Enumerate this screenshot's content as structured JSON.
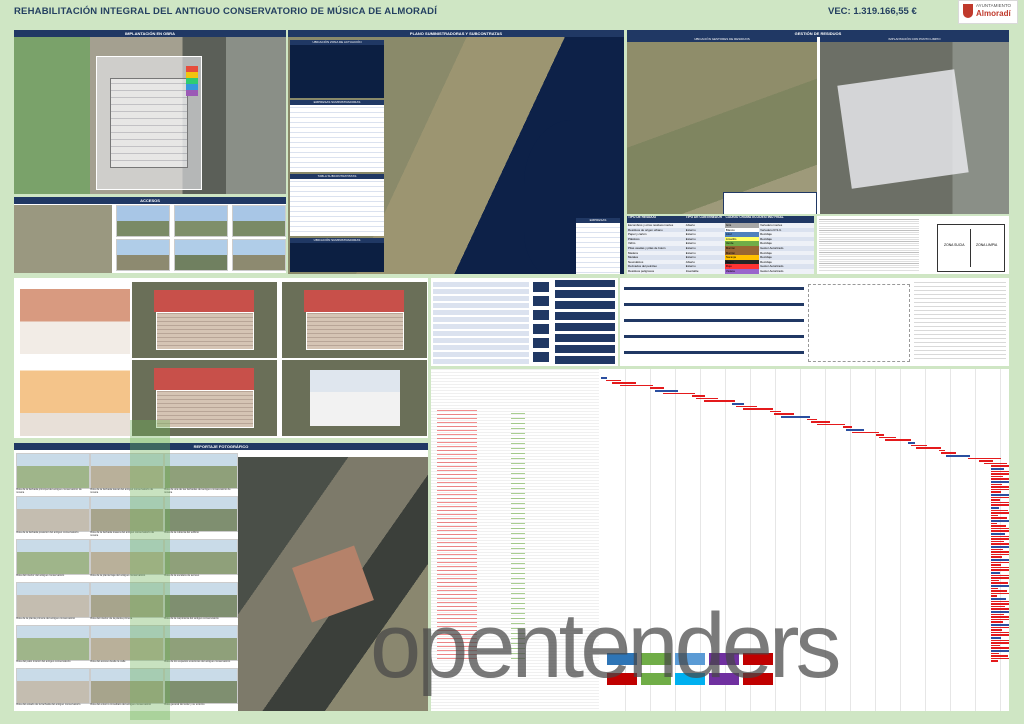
{
  "header": {
    "title": "REHABILITACIÓN INTEGRAL DEL ANTIGUO CONSERVATORIO DE MÚSICA DE ALMORADÍ",
    "vec": "VEC: 1.319.166,55 €"
  },
  "logo": {
    "line1": "AYUNTAMIENTO",
    "line2": "Almoradí",
    "color": "#c0392b"
  },
  "panels": {
    "implantacion": "IMPLANTACIÓN EN OBRA",
    "plano_suministradoras": "PLANO SUMINISTRADORAS Y SUBCONTRATAS",
    "gestion_residuos": "GESTIÓN DE RESIDUOS",
    "accesos": "ACCESOS",
    "reportaje": "REPORTAJE FOTOGRÁFICO",
    "ubicacion_zona": "UBICACIÓN ZONA DE ACTUACIÓN",
    "empresas_suministradoras": "EMPRESAS SUMINISTRADORAS",
    "tabla_subcontratistas": "TABLA SUBCONTRATISTAS",
    "ubicacion_suministradoras": "UBICACIÓN SUMINISTRADORAS",
    "empresas": "EMPRESAS",
    "ubicacion_gestores": "UBICACIÓN GESTORES DE RESIDUOS",
    "implantacion_punto_limpio": "IMPLANTACIÓN CON PUNTO LIMPIO",
    "zona_sucia": "ZONA SUCIA",
    "zona_limpia": "ZONA LIMPIA"
  },
  "residuos_table": {
    "headers": [
      "TIPO DE RESIDUO",
      "TIPO DE CONTENEDOR",
      "CÓDIGO CROMÁTICO",
      "DESTINO FINAL"
    ],
    "rows": [
      [
        "Escombros y otros residuos inertes",
        "Abierto",
        "Gris",
        "Vertedero inertes"
      ],
      [
        "Residuos de origen urbano",
        "Externo",
        "Blanco",
        "Vertedero R.S.U."
      ],
      [
        "Papel y cartón",
        "Externo",
        "Azul",
        "Reciclaje"
      ],
      [
        "Plásticos",
        "Externo",
        "Amarillo",
        "Reciclaje"
      ],
      [
        "Vidrio",
        "Externo",
        "Verde",
        "Reciclaje"
      ],
      [
        "Pilas usadas y pilas de botón",
        "Externo",
        "Marrón",
        "Gestor Autorizado"
      ],
      [
        "Madera",
        "Externo",
        "Marrón",
        "Reciclaje"
      ],
      [
        "Metales",
        "Externo",
        "Naranja",
        "Reciclaje"
      ],
      [
        "Neumáticos",
        "Abierto",
        "Negro",
        "Reciclaje"
      ],
      [
        "Derivados del petróleo",
        "Externo",
        "Rojo",
        "Gestor Autorizado"
      ],
      [
        "Residuos peligrosos",
        "Insertable",
        "Violeta",
        "Gestor Autorizado"
      ]
    ],
    "chip_colors": [
      "#a6a6a6",
      "#ffffff",
      "#4f81bd",
      "#ffff66",
      "#70ad47",
      "#996633",
      "#996633",
      "#ffc000",
      "#262626",
      "#ff3333",
      "#9966cc"
    ]
  },
  "photo_captions": [
    "Vista de la fachada principal del antiguo conservatorio de música",
    "Vista de la fachada lateral del antiguo conservatorio de música",
    "Vista de una de las fachadas del antiguo conservatorio de música",
    "Vista de la fachada posterior del antiguo conservatorio",
    "Vista de la fachada trasera del antiguo conservatorio de música",
    "Vista de la cubierta del edificio",
    "Vista del interior del antiguo conservatorio",
    "Vista de la planta baja del antiguo conservatorio",
    "Vista de la escalera de acceso",
    "Vista de la planta primera del antiguo conservatorio",
    "Vista del interior de la planta primera",
    "Vista de la carpintería del antiguo conservatorio",
    "Vista del patio interior del antiguo conservatorio",
    "Vista del acceso desde la calle",
    "Vista de los espacios exteriores del antiguo conservatorio",
    "Vista del estado de la fachada del antiguo conservatorio",
    "Vista del entorno inmediato del antiguo conservatorio",
    "Vista general del solar y su entorno"
  ],
  "watermark": "opentenders",
  "colors": {
    "background": "#cfe6c4",
    "header_blue": "#203864",
    "gantt_red": "#e41a1c",
    "roof_red": "#c8504a"
  }
}
